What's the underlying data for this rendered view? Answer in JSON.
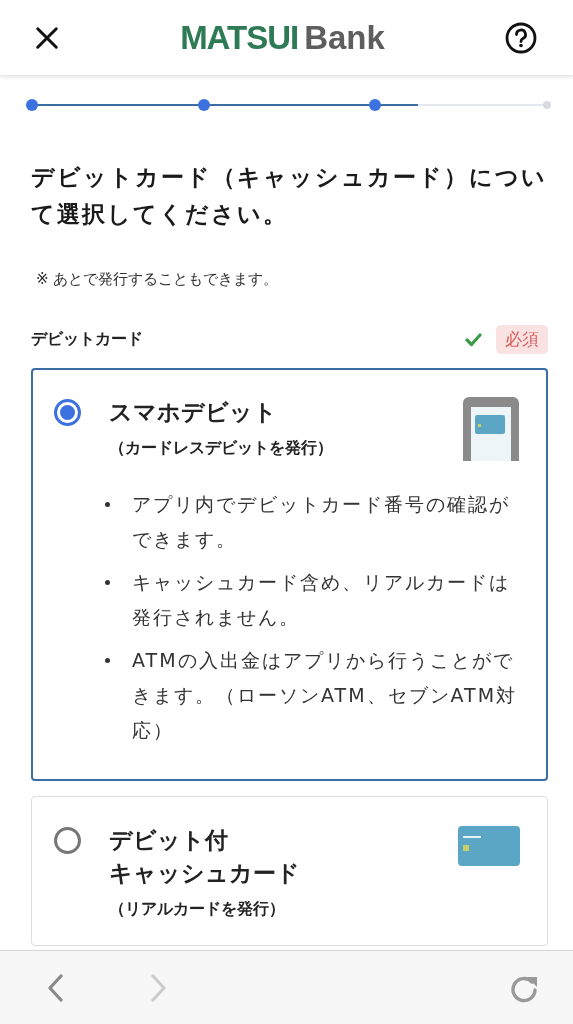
{
  "header": {
    "logo_primary": "MATSUI",
    "logo_secondary": "Bank"
  },
  "progress": {
    "level": 0.75,
    "steps": [
      {
        "done": true
      },
      {
        "done": true
      },
      {
        "done": true
      },
      {
        "done": false
      }
    ]
  },
  "title": "デビットカード（キャッシュカード）について選択してください。",
  "note": "※ あとで発行することもできます。",
  "section": {
    "label": "デビットカード",
    "valid": true,
    "badge": "必須"
  },
  "options": [
    {
      "selected": true,
      "title_lines": [
        "スマホデビット"
      ],
      "subtitle": "（カードレスデビットを発行）",
      "kind": "phone",
      "bullets": [
        "アプリ内でデビットカード番号の確認ができます。",
        "キャッシュカード含め、リアルカードは発行されません。",
        "ATMの入出金はアプリから行うことができます。（ローソンATM、セブンATM対応）"
      ]
    },
    {
      "selected": false,
      "title_lines": [
        "デビット付",
        "キャッシュカード"
      ],
      "subtitle": "（リアルカードを発行）",
      "kind": "card"
    }
  ],
  "toolbar": {
    "back_disabled": false,
    "forward_disabled": true
  }
}
